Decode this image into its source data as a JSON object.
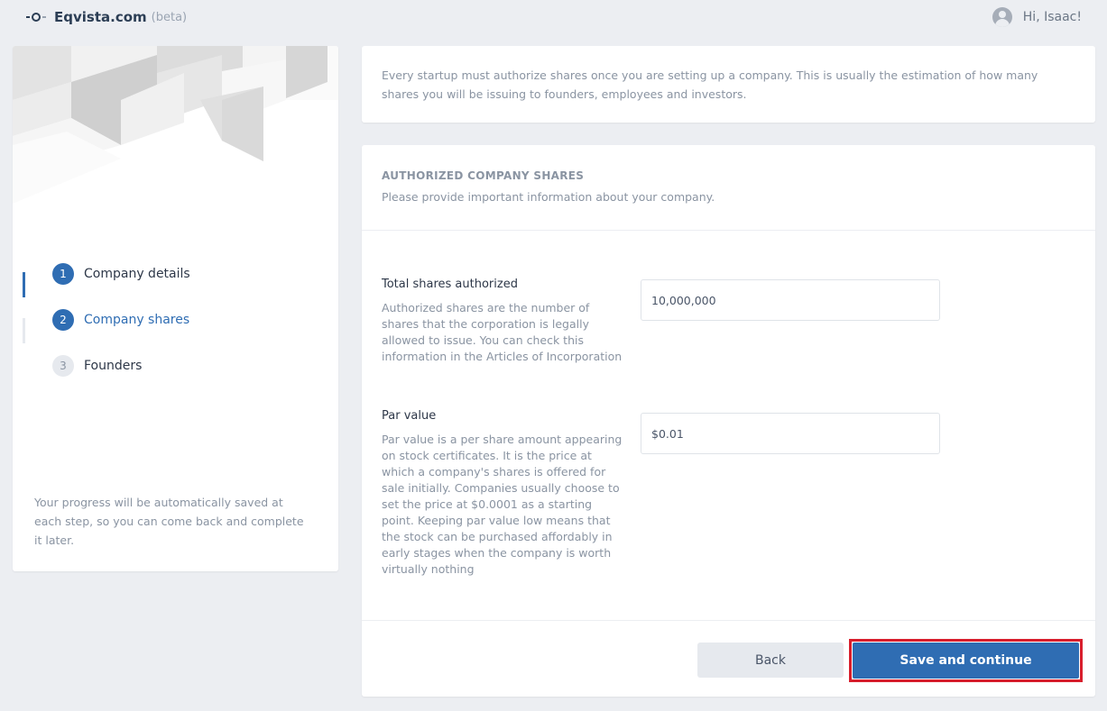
{
  "header": {
    "brand": "Eqvista.com",
    "beta": "(beta)",
    "greeting": "Hi, Isaac!"
  },
  "steps": [
    {
      "number": "1",
      "label": "Company details",
      "state": "done"
    },
    {
      "number": "2",
      "label": "Company shares",
      "state": "active"
    },
    {
      "number": "3",
      "label": "Founders",
      "state": "pending"
    }
  ],
  "progress_note": "Your progress will be automatically saved at each step, so you can come back and complete it later.",
  "intro": "Every startup must authorize shares once you are setting up a company. This is usually the estimation of how many shares you will be issuing to founders, employees and investors.",
  "form": {
    "title": "AUTHORIZED COMPANY SHARES",
    "subtitle": "Please provide important information about your company.",
    "fields": [
      {
        "label": "Total shares authorized",
        "help": "Authorized shares are the number of shares that the corporation is legally allowed to issue. You can check this information in the Articles of Incorporation",
        "value": "10,000,000"
      },
      {
        "label": "Par value",
        "help": "Par value is a per share amount appearing on stock certificates. It is the price at which a company's shares is offered for sale initially. Companies usually choose to set the price at $0.0001 as a starting point. Keeping par value low means that the stock can be purchased affordably in early stages when the company is worth virtually nothing",
        "value": "$0.01"
      }
    ],
    "back_label": "Back",
    "save_label": "Save and continue"
  },
  "colors": {
    "accent": "#2f6db3",
    "highlight": "#d81e2c",
    "background": "#eceef2"
  },
  "icons": {
    "logo": "eqvista-logo-icon",
    "avatar": "user-avatar-icon"
  }
}
